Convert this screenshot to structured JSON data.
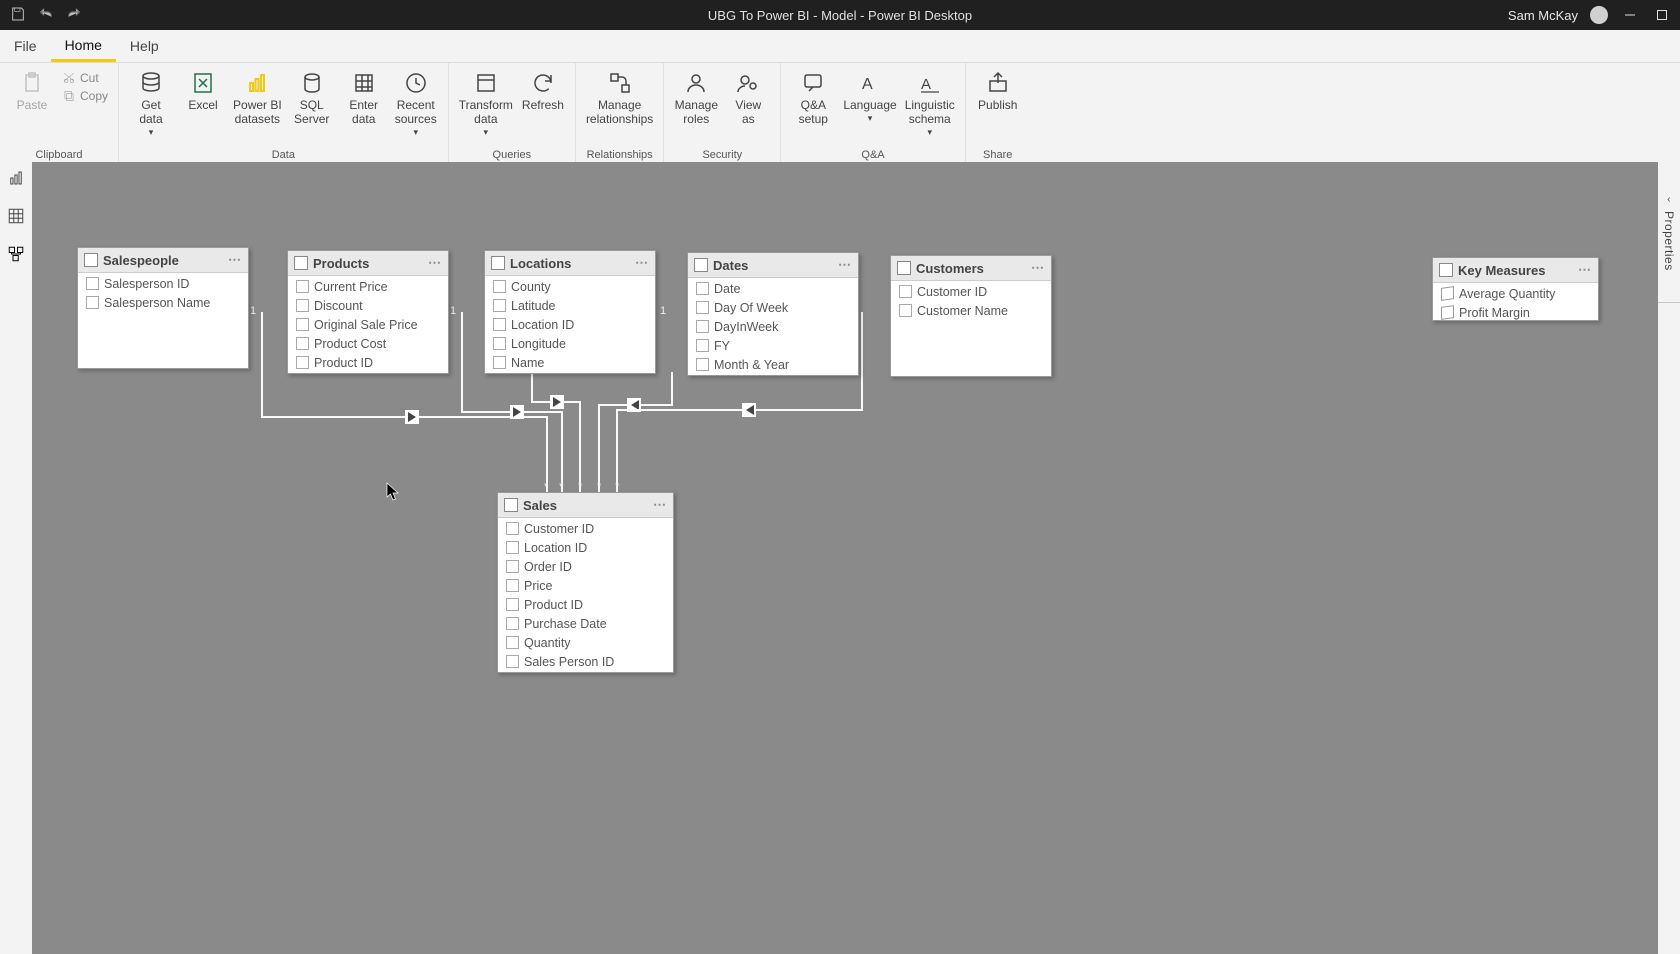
{
  "titlebar": {
    "title": "UBG To Power BI - Model - Power BI Desktop",
    "username": "Sam McKay"
  },
  "menubar": {
    "file": "File",
    "home": "Home",
    "help": "Help"
  },
  "ribbon": {
    "clipboard": {
      "label": "Clipboard",
      "paste": "Paste",
      "cut": "Cut",
      "copy": "Copy"
    },
    "data": {
      "label": "Data",
      "get_data": "Get\ndata",
      "excel": "Excel",
      "pbi_datasets": "Power BI\ndatasets",
      "sql_server": "SQL\nServer",
      "enter_data": "Enter\ndata",
      "recent_sources": "Recent\nsources"
    },
    "queries": {
      "label": "Queries",
      "transform": "Transform\ndata",
      "refresh": "Refresh"
    },
    "relationships": {
      "label": "Relationships",
      "manage": "Manage\nrelationships"
    },
    "security": {
      "label": "Security",
      "manage_roles": "Manage\nroles",
      "view_as": "View\nas"
    },
    "qa": {
      "label": "Q&A",
      "qa_setup": "Q&A\nsetup",
      "language": "Language",
      "linguistic": "Linguistic\nschema"
    },
    "share": {
      "label": "Share",
      "publish": "Publish"
    }
  },
  "right_pane": {
    "label": "Properties"
  },
  "tables": {
    "salespeople": {
      "name": "Salespeople",
      "fields": [
        "Salesperson ID",
        "Salesperson Name"
      ]
    },
    "products": {
      "name": "Products",
      "fields": [
        "Current Price",
        "Discount",
        "Original Sale Price",
        "Product Cost",
        "Product ID"
      ]
    },
    "locations": {
      "name": "Locations",
      "fields": [
        "County",
        "Latitude",
        "Location ID",
        "Longitude",
        "Name"
      ]
    },
    "dates": {
      "name": "Dates",
      "fields": [
        "Date",
        "Day Of Week",
        "DayInWeek",
        "FY",
        "Month & Year"
      ]
    },
    "customers": {
      "name": "Customers",
      "fields": [
        "Customer ID",
        "Customer Name"
      ]
    },
    "key_measures": {
      "name": "Key Measures",
      "fields": [
        "Average Quantity",
        "Profit Margin"
      ]
    },
    "sales": {
      "name": "Sales",
      "fields": [
        "Customer ID",
        "Location ID",
        "Order ID",
        "Price",
        "Product ID",
        "Purchase Date",
        "Quantity",
        "Sales Person ID"
      ]
    }
  },
  "relationship_cardinality": {
    "one": "1",
    "many": "*"
  }
}
